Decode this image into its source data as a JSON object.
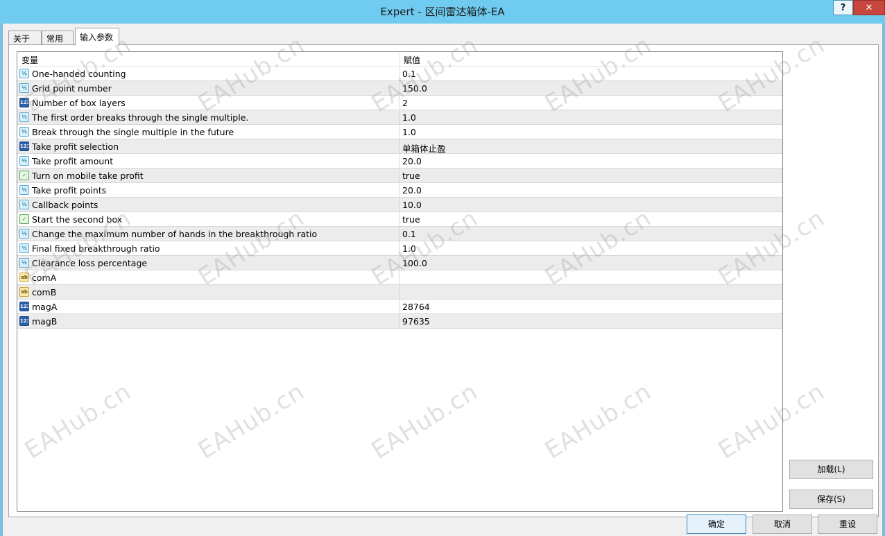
{
  "window": {
    "title": "Expert - 区间雷达箱体-EA",
    "help_label": "?",
    "close_label": "✕"
  },
  "tabs": [
    {
      "label": "关于"
    },
    {
      "label": "常用"
    },
    {
      "label": "输入参数"
    }
  ],
  "grid": {
    "col_variable": "变量",
    "col_value": "赋值",
    "rows": [
      {
        "icon": "double",
        "icon_text": "½",
        "name": "One-handed counting",
        "value": "0.1"
      },
      {
        "icon": "double",
        "icon_text": "½",
        "name": "Grid point number",
        "value": "150.0"
      },
      {
        "icon": "int",
        "icon_text": "123",
        "name": "Number of box layers",
        "value": "2"
      },
      {
        "icon": "double",
        "icon_text": "½",
        "name": "The first order breaks through the single multiple.",
        "value": "1.0"
      },
      {
        "icon": "double",
        "icon_text": "½",
        "name": "Break through the single multiple in the future",
        "value": "1.0"
      },
      {
        "icon": "int",
        "icon_text": "123",
        "name": "Take profit selection",
        "value": "单箱体止盈"
      },
      {
        "icon": "double",
        "icon_text": "½",
        "name": "Take profit amount",
        "value": "20.0"
      },
      {
        "icon": "bool",
        "icon_text": "✓",
        "name": "Turn on mobile take profit",
        "value": "true"
      },
      {
        "icon": "double",
        "icon_text": "½",
        "name": "Take profit points",
        "value": "20.0"
      },
      {
        "icon": "double",
        "icon_text": "½",
        "name": "Callback points",
        "value": "10.0"
      },
      {
        "icon": "bool",
        "icon_text": "✓",
        "name": "Start the second box",
        "value": "true"
      },
      {
        "icon": "double",
        "icon_text": "½",
        "name": "Change the maximum number of hands in the breakthrough ratio",
        "value": "0.1"
      },
      {
        "icon": "double",
        "icon_text": "½",
        "name": "Final fixed breakthrough ratio",
        "value": "1.0"
      },
      {
        "icon": "double",
        "icon_text": "½",
        "name": "Clearance loss percentage",
        "value": "100.0"
      },
      {
        "icon": "string",
        "icon_text": "ab",
        "name": "comA",
        "value": ""
      },
      {
        "icon": "string",
        "icon_text": "ab",
        "name": "comB",
        "value": ""
      },
      {
        "icon": "int",
        "icon_text": "123",
        "name": "magA",
        "value": "28764"
      },
      {
        "icon": "int",
        "icon_text": "123",
        "name": "magB",
        "value": "97635"
      }
    ]
  },
  "buttons": {
    "load": "加载(L)",
    "save": "保存(S)",
    "ok": "确定",
    "cancel": "取消",
    "reset": "重设"
  },
  "watermark": "EAHub.cn",
  "colors": {
    "titlebar": "#6fcbef",
    "close": "#c7463d",
    "row_alt": "#ececec"
  }
}
